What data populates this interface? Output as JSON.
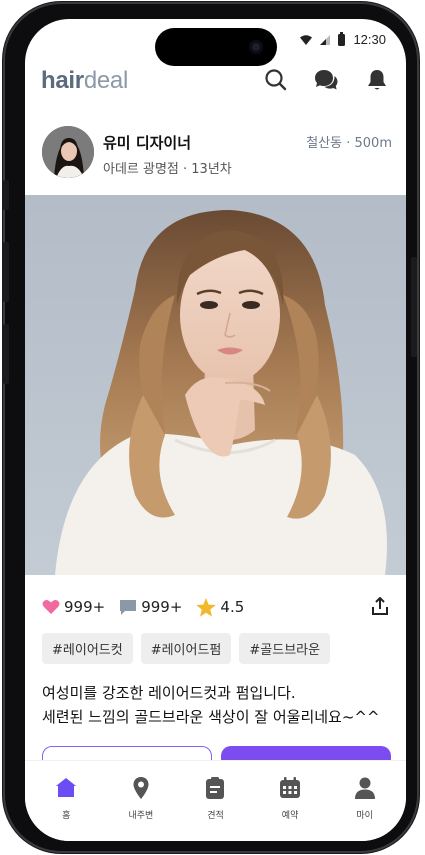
{
  "status_bar": {
    "time": "12:30"
  },
  "app": {
    "logo_bold": "hair",
    "logo_light": "deal"
  },
  "designer": {
    "name": "유미 디자이너",
    "salon_info": "아데르 광명점 · 13년차",
    "location": "철산동 · 500m"
  },
  "stats": {
    "likes": "999+",
    "comments": "999+",
    "rating": "4.5"
  },
  "tags": [
    "#레이어드컷",
    "#레이어드펌",
    "#골드브라운"
  ],
  "description": [
    "여성미를 강조한 레이어드컷과 펌입니다.",
    "세련된 느낌의 골드브라운 색상이 잘 어울리네요~^^"
  ],
  "tabs": [
    {
      "label": "홈",
      "icon": "home-icon",
      "active": true
    },
    {
      "label": "내주변",
      "icon": "location-pin-icon",
      "active": false
    },
    {
      "label": "견적",
      "icon": "clipboard-icon",
      "active": false
    },
    {
      "label": "예약",
      "icon": "calendar-icon",
      "active": false
    },
    {
      "label": "마이",
      "icon": "person-icon",
      "active": false
    }
  ],
  "colors": {
    "accent": "#7d4cf0",
    "active_tab": "#6b4cf5",
    "inactive_tab": "#555555",
    "heart": "#f06aa0",
    "star": "#f2b82c",
    "comment": "#8a98a8"
  }
}
